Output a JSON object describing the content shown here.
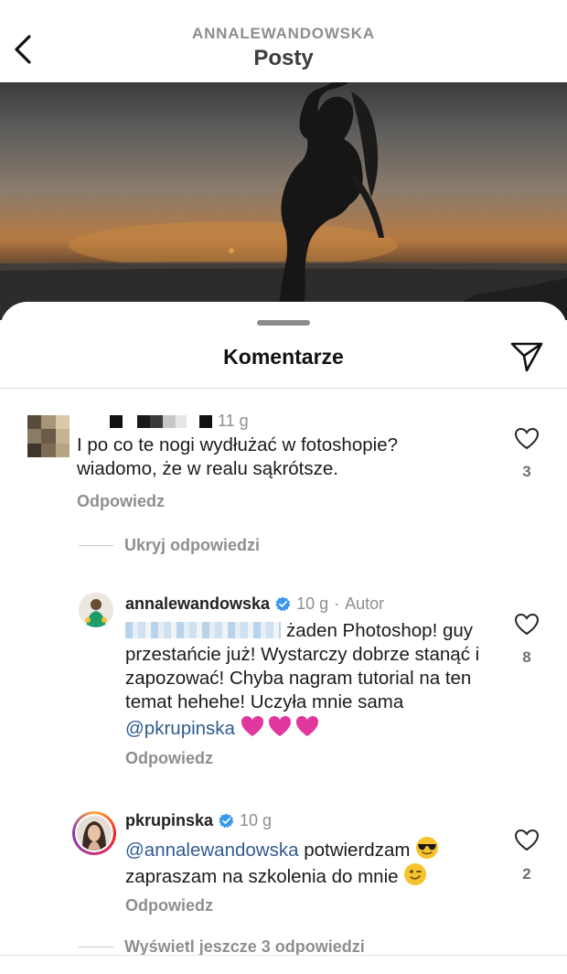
{
  "header": {
    "username": "ANNALEWANDOWSKA",
    "title": "Posty"
  },
  "sheet": {
    "title": "Komentarze"
  },
  "comments": [
    {
      "time": "11 g",
      "text": "I po co te nogi wydłużać w fotoshopie? wiadomo, że w realu sąkrótsze.",
      "reply_label": "Odpowiedz",
      "likes": "3"
    }
  ],
  "hide_replies_label": "Ukryj odpowiedzi",
  "replies": [
    {
      "username": "annalewandowska",
      "time": "10 g",
      "separator": "·",
      "badge": "Autor",
      "text_part1": "żaden Photoshop! guy przestańcie już! Wystarczy dobrze stanąć i zapozować! Chyba nagram tutorial na ten temat hehehe! Uczyła mnie sama",
      "mention": "@pkrupinska",
      "reply_label": "Odpowiedz",
      "likes": "8"
    },
    {
      "username": "pkrupinska",
      "time": "10 g",
      "mention": "@annalewandowska",
      "text_part1": "potwierdzam",
      "text_part2": "zapraszam na szkolenia do mnie",
      "reply_label": "Odpowiedz",
      "likes": "2"
    }
  ],
  "view_more_label": "Wyświetl jeszcze 3 odpowiedzi",
  "colors": {
    "verified": "#3897f0",
    "mention": "#315b91",
    "heart_emoji": "#e0389c",
    "muted": "#8e8e8e"
  },
  "icons": [
    "back-chevron-icon",
    "paper-plane-icon",
    "heart-outline-icon",
    "verified-badge-icon"
  ]
}
